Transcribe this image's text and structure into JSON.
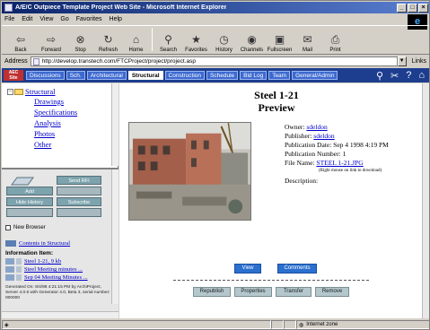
{
  "window": {
    "title": "A/E/C Outpiece Template Project Web Site - Microsoft Internet Explorer"
  },
  "menu": [
    "File",
    "Edit",
    "View",
    "Go",
    "Favorites",
    "Help"
  ],
  "toolbar": {
    "buttons": [
      {
        "label": "Back",
        "icon": "back-arrow-icon"
      },
      {
        "label": "Forward",
        "icon": "forward-arrow-icon"
      },
      {
        "label": "Stop",
        "icon": "stop-icon"
      },
      {
        "label": "Refresh",
        "icon": "refresh-icon"
      },
      {
        "label": "Home",
        "icon": "home-icon"
      },
      {
        "label": "Search",
        "icon": "search-icon"
      },
      {
        "label": "Favorites",
        "icon": "favorites-icon"
      },
      {
        "label": "History",
        "icon": "history-icon"
      },
      {
        "label": "Channels",
        "icon": "channels-icon"
      },
      {
        "label": "Fullscreen",
        "icon": "fullscreen-icon"
      },
      {
        "label": "Mail",
        "icon": "mail-icon"
      },
      {
        "label": "Print",
        "icon": "print-icon"
      }
    ]
  },
  "address": {
    "label": "Address",
    "url": "http://develop.transtech.com/FTCProject/project/project.asp",
    "links_label": "Links"
  },
  "site_nav": {
    "tabs": [
      "Discussions",
      "Sch.",
      "Architectural",
      "Structural",
      "Construction",
      "Schedule",
      "Bid Log",
      "Team",
      "General/Admin"
    ],
    "active_index": 3
  },
  "tree": {
    "root": "Structural",
    "children": [
      "Drawings",
      "Specifications",
      "Analysis",
      "Photos",
      "Other"
    ]
  },
  "panel": {
    "buttons": [
      "Send RFI",
      "Add",
      "Hide History",
      "Subscribe"
    ],
    "checkbox_label": "New Browser",
    "contents_link": "Contents in Structural",
    "info_heading": "Information Item:",
    "items": [
      "Steel 1-21, 9 kb",
      "Steel Meeting minutes ...",
      "Sep 04 Meeting Minutes ..."
    ],
    "footer": "Generated On: 9/4/98 4:21:15 PM by ArchiProject, Server 4.0.6 with Generator 4.0, Beta 3, serial number: 000000"
  },
  "document": {
    "title_line1": "Steel 1-21",
    "title_line2": "Preview",
    "owner_label": "Owner:",
    "owner": "sdeldon",
    "publisher_label": "Publisher:",
    "publisher": "sdeldon",
    "pub_date_label": "Publication Date:",
    "pub_date": "Sep 4 1998 4:19 PM",
    "pub_number_label": "Publication Number:",
    "pub_number": "1",
    "file_name_label": "File Name:",
    "file_name": "STEEL 1-21.JPG",
    "file_note": "(Right mouse on link to download)",
    "description_label": "Description:",
    "buttons": {
      "view": "View",
      "comments": "Comments",
      "republish": "Republish",
      "properties": "Properties",
      "transfer": "Transfer",
      "remove": "Remove"
    }
  },
  "status": {
    "done_icon": "page-icon",
    "zone": "Internet zone"
  },
  "colors": {
    "title_bar": "#0a246a",
    "site_nav": "#1d3e8f",
    "link": "#0000cc",
    "view_button": "#2b6fcf"
  }
}
